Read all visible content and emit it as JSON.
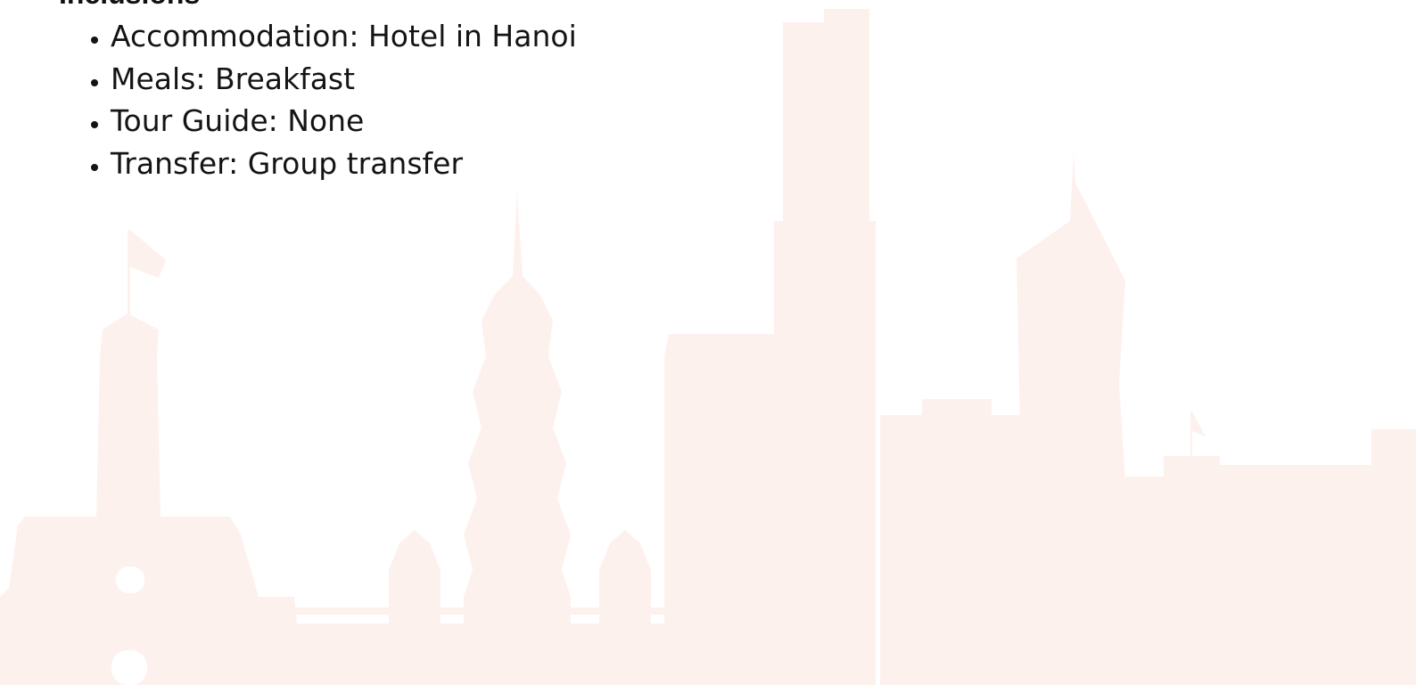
{
  "inclusions": {
    "heading": "Inclusions",
    "items": [
      {
        "label": "Accommodation",
        "value": "Hotel in Hanoi"
      },
      {
        "label": "Meals",
        "value": "Breakfast"
      },
      {
        "label": "Tour Guide",
        "value": "None"
      },
      {
        "label": "Transfer",
        "value": "Group transfer"
      }
    ]
  },
  "theme": {
    "text_color": "#141414",
    "skyline_color": "#fdf1ee"
  }
}
